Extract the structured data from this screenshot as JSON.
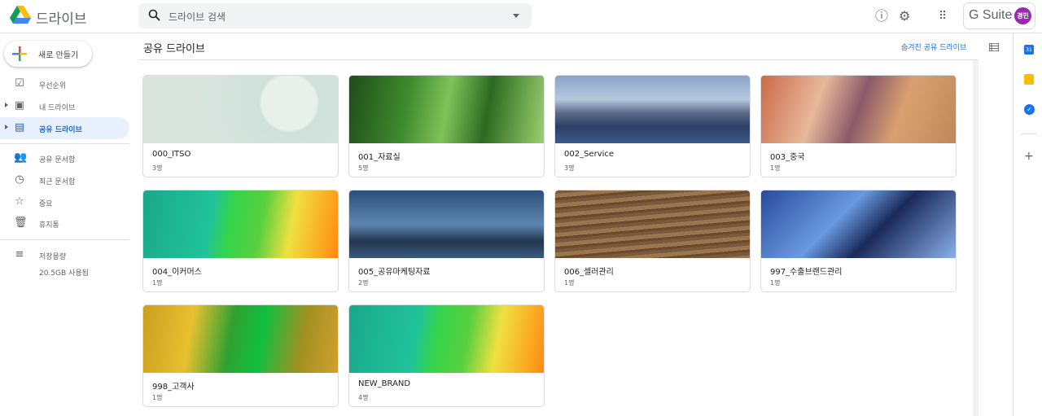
{
  "header": {
    "brand": "드라이브",
    "search_placeholder": "드라이브 검색",
    "gsuite": "G Suite",
    "avatar": "경민",
    "icons": [
      "help-icon",
      "settings-icon",
      "apps-icon"
    ]
  },
  "sidebar": {
    "new_label": "새로 만들기",
    "items": [
      {
        "label": "우선순위",
        "icon": "☑"
      },
      {
        "label": "내 드라이브",
        "icon": "▣"
      },
      {
        "label": "공유 드라이브",
        "icon": "▤"
      },
      {
        "label": "공유 문서함",
        "icon": "👥"
      },
      {
        "label": "최근 문서함",
        "icon": "◷"
      },
      {
        "label": "중요",
        "icon": "☆"
      },
      {
        "label": "휴지통",
        "icon": "🗑"
      },
      {
        "label": "저장용량",
        "icon": "≡"
      }
    ],
    "storage_used": "20.5GB 사용됨"
  },
  "main": {
    "title": "공유 드라이브",
    "hidden_link": "숨겨진 공유 드라이브",
    "drives": [
      {
        "name": "000_ITSO",
        "members": "3명",
        "bg": "radial-gradient(circle at 75% 40%,#e8f0ec 0 18%,#cfe0da 20%,#d9e4df 60%),linear-gradient(90deg,#e6d8d4,#d3e2dc)"
      },
      {
        "name": "001_자료실",
        "members": "5명",
        "bg": "linear-gradient(100deg,#1f4d1a,#3f8a2e 30%,#7fc25a 50%,#2c6a20 70%,#9cd070)"
      },
      {
        "name": "002_Service",
        "members": "3명",
        "bg": "linear-gradient(180deg,#8aa3c8 0,#b8c8de 35%,#5b6b8a 55%,#2d3f66 75%,#3d5a8a)"
      },
      {
        "name": "003_중국",
        "members": "1명",
        "bg": "linear-gradient(110deg,#c96a48,#e8b89a 30%,#8a5a6a 50%,#d9a070 70%,#c08858)"
      },
      {
        "name": "004_이커머스",
        "members": "1명",
        "bg": "linear-gradient(100deg,#1aa88a,#21c39a 35%,#34d44a 45%,#5ad040 60%,#f0e040 75%,#ff8a10)"
      },
      {
        "name": "005_공유마케팅자료",
        "members": "2명",
        "bg": "linear-gradient(180deg,#2a4f7a,#5f86b0 50%,#23364f 75%,#3a5a80)"
      },
      {
        "name": "006_셀러관리",
        "members": "1명",
        "bg": "repeating-linear-gradient(175deg,#7a5a3a 0 4px,#9a7650 4px 9px,#6a4a2c 9px 12px)"
      },
      {
        "name": "997_수출브랜드관리",
        "members": "1명",
        "bg": "linear-gradient(135deg,#2a4a9a,#6a9ae0 40%,#1a2a5a 60%,#8ab0ea)"
      },
      {
        "name": "998_고객사",
        "members": "1명",
        "bg": "linear-gradient(100deg,#c8a020,#e8c030 25%,#30a030 45%,#10c040 60%,#a09020 80%,#d0a030)"
      },
      {
        "name": "NEW_BRAND",
        "members": "4명",
        "bg": "linear-gradient(100deg,#1aa88a,#21c39a 35%,#34d44a 45%,#5ad040 60%,#f0e040 75%,#ff8a10)"
      }
    ]
  },
  "side_panel": {
    "icons": [
      "calendar-icon",
      "keep-icon",
      "tasks-icon",
      "add-icon"
    ],
    "colors": {
      "calendar": "#1a73e8",
      "keep": "#fbbc04",
      "tasks": "#1a73e8"
    }
  }
}
